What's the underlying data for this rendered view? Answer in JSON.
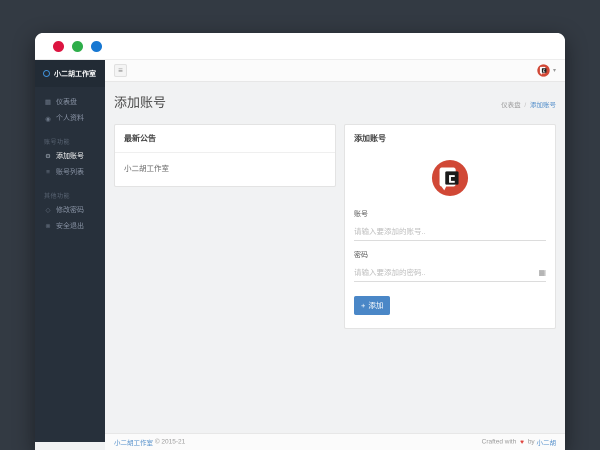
{
  "window": {
    "traffic_light_colors": {
      "close": "#dc1440",
      "minimize": "#2eae4a",
      "zoom": "#1677d2"
    }
  },
  "topbar": {
    "menu_toggle_glyph": "≡",
    "user_caret_glyph": "▾"
  },
  "sidebar": {
    "brand": {
      "name": "小二胡工作室"
    },
    "groups": [
      {
        "items": [
          {
            "icon": "dashboard-icon",
            "glyph": "▦",
            "label": "仪表盘"
          },
          {
            "icon": "profile-icon",
            "glyph": "◉",
            "label": "个人资料"
          }
        ]
      },
      {
        "header": "账号功能",
        "items": [
          {
            "icon": "add-account-icon",
            "glyph": "⊙",
            "label": "添加账号",
            "active": true
          },
          {
            "icon": "account-list-icon",
            "glyph": "≡",
            "label": "账号列表"
          }
        ]
      },
      {
        "header": "其他功能",
        "items": [
          {
            "icon": "change-password-icon",
            "glyph": "◇",
            "label": "修改密码"
          },
          {
            "icon": "logout-icon",
            "glyph": "⊗",
            "label": "安全退出"
          }
        ]
      }
    ]
  },
  "page": {
    "title": "添加账号",
    "breadcrumb": {
      "parent": "仪表盘",
      "separator": "/",
      "current": "添加账号"
    }
  },
  "notice_card": {
    "title": "最新公告",
    "content": "小二胡工作室"
  },
  "form_card": {
    "title": "添加账号",
    "fields": [
      {
        "label": "账号",
        "placeholder": "请输入要添加的账号.."
      },
      {
        "label": "密码",
        "placeholder": "请输入要添加的密码..",
        "trailing_glyph": "▦"
      }
    ],
    "submit": {
      "icon_glyph": "+",
      "label": "添加"
    }
  },
  "footer": {
    "brand": "小二胡工作室",
    "copyright": "© 2015-21",
    "credit_prefix": "Crafted with",
    "credit_heart": "♥",
    "credit_middle": "by",
    "credit_author": "小二胡"
  },
  "colors": {
    "accent_blue": "#4a87c7",
    "link_blue": "#4d8bc9",
    "logo_red": "#d14836",
    "sidebar_bg": "#27303b",
    "desktop_bg": "#333a43"
  }
}
